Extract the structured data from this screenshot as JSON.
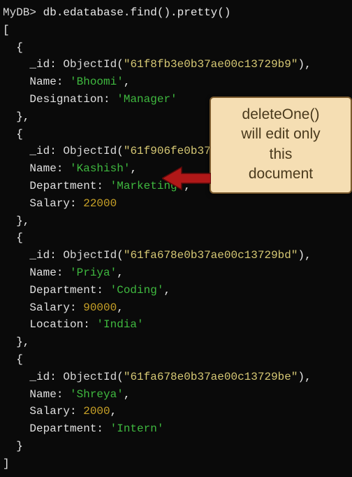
{
  "prompt": "MyDB>",
  "command": "db.edatabase.find().pretty()",
  "brackets": {
    "open": "[",
    "close": "]"
  },
  "braces": {
    "open": "{",
    "close": "},",
    "close_last": "}"
  },
  "labels": {
    "id": "_id",
    "name": "Name",
    "designation": "Designation",
    "department": "Department",
    "salary": "Salary",
    "location": "Location",
    "objectid": "ObjectId"
  },
  "docs": [
    {
      "id": "61f8fb3e0b37ae00c13729b9",
      "fields": [
        {
          "k": "Name",
          "v": "'Bhoomi'",
          "t": "str"
        },
        {
          "k": "Designation",
          "v": "'Manager'",
          "t": "str"
        }
      ]
    },
    {
      "id": "61f906fe0b37",
      "fields": [
        {
          "k": "Name",
          "v": "'Kashish'",
          "t": "str"
        },
        {
          "k": "Department",
          "v": "'Marketing'",
          "t": "str"
        },
        {
          "k": "Salary",
          "v": "22000",
          "t": "num"
        }
      ]
    },
    {
      "id": "61fa678e0b37ae00c13729bd",
      "fields": [
        {
          "k": "Name",
          "v": "'Priya'",
          "t": "str"
        },
        {
          "k": "Department",
          "v": "'Coding'",
          "t": "str"
        },
        {
          "k": "Salary",
          "v": "90000",
          "t": "num"
        },
        {
          "k": "Location",
          "v": "'India'",
          "t": "str"
        }
      ]
    },
    {
      "id": "61fa678e0b37ae00c13729be",
      "fields": [
        {
          "k": "Name",
          "v": "'Shreya'",
          "t": "str"
        },
        {
          "k": "Salary",
          "v": "2000",
          "t": "num"
        },
        {
          "k": "Department",
          "v": "'Intern'",
          "t": "str"
        }
      ]
    }
  ],
  "callout": {
    "line1": "deleteOne()",
    "line2": "will edit only",
    "line3": "this",
    "line4": "document"
  },
  "colors": {
    "bg": "#0a0a0a",
    "string": "#3fb93f",
    "number": "#c9a227",
    "oid": "#d6c874",
    "callout_bg": "#f5deb3",
    "callout_border": "#7a5a2d",
    "arrow": "#b01818"
  }
}
